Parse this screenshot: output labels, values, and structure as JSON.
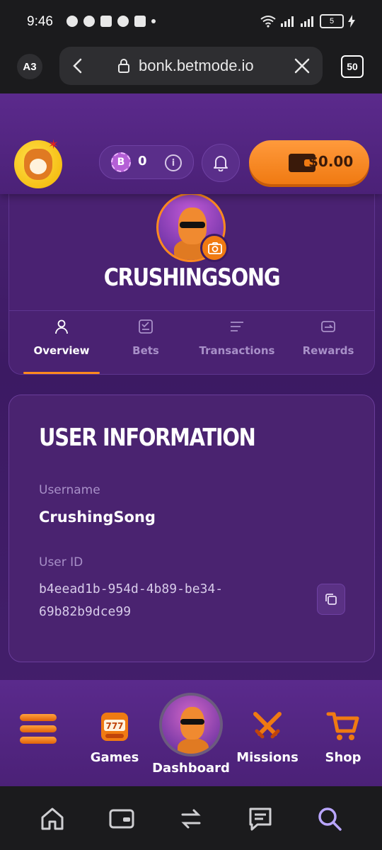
{
  "status_bar": {
    "time": "9:46",
    "battery": "5",
    "app_icons": [
      "whatsapp-icon",
      "messenger-icon",
      "discord-icon",
      "telegram-icon",
      "youtube-icon"
    ]
  },
  "browser": {
    "profile_badge": "A3",
    "url": "bonk.betmode.io",
    "tab_count": "50"
  },
  "header": {
    "bonk_balance": "0",
    "bonk_coin_letter": "B",
    "wallet_balance": "$0.00"
  },
  "profile": {
    "username": "CRUSHINGSONG",
    "tabs": [
      {
        "label": "Overview",
        "active": true
      },
      {
        "label": "Bets",
        "active": false
      },
      {
        "label": "Transactions",
        "active": false
      },
      {
        "label": "Rewards",
        "active": false
      }
    ]
  },
  "user_information": {
    "title": "USER INFORMATION",
    "username_label": "Username",
    "username_value": "CrushingSong",
    "userid_label": "User ID",
    "userid_value": "b4eead1b-954d-4b89-be34-69b82b9dce99"
  },
  "bottom_nav": {
    "items": [
      {
        "label": "Games"
      },
      {
        "label": "Dashboard"
      },
      {
        "label": "Missions"
      },
      {
        "label": "Shop"
      }
    ]
  },
  "colors": {
    "accent": "#f07a12",
    "background": "#3c1a63"
  }
}
